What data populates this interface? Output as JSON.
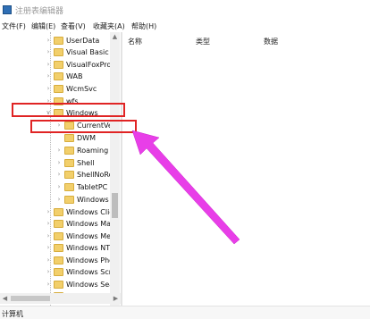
{
  "window": {
    "title": "注册表编辑器"
  },
  "menu": [
    "文件(F)",
    "编辑(E)",
    "查看(V)",
    "收藏夹(A)",
    "帮助(H)"
  ],
  "tree": {
    "items": [
      {
        "label": "UserData",
        "expand": "›"
      },
      {
        "label": "Visual Basic",
        "expand": "›"
      },
      {
        "label": "VisualFoxPro",
        "expand": "›"
      },
      {
        "label": "WAB",
        "expand": "›"
      },
      {
        "label": "WcmSvc",
        "expand": "›"
      },
      {
        "label": "wfs",
        "expand": "›"
      },
      {
        "label": "Windows",
        "expand": "∨"
      },
      {
        "label": "CurrentVe",
        "expand": "›"
      },
      {
        "label": "DWM",
        "expand": ""
      },
      {
        "label": "Roaming",
        "expand": "›"
      },
      {
        "label": "Shell",
        "expand": "›"
      },
      {
        "label": "ShellNoRo",
        "expand": "›"
      },
      {
        "label": "TabletPC",
        "expand": "›"
      },
      {
        "label": "Windows",
        "expand": "›"
      },
      {
        "label": "Windows Clie",
        "expand": "›"
      },
      {
        "label": "Windows Ma",
        "expand": "›"
      },
      {
        "label": "Windows Me",
        "expand": "›"
      },
      {
        "label": "Windows NT",
        "expand": "›"
      },
      {
        "label": "Windows Pho",
        "expand": "›"
      },
      {
        "label": "Windows Scr",
        "expand": "›"
      },
      {
        "label": "Windows Sea",
        "expand": "›"
      },
      {
        "label": "Windows Sel",
        "expand": "›"
      }
    ]
  },
  "columns": {
    "name": "名称",
    "type": "类型",
    "data": "数据"
  },
  "status": {
    "text": "计算机"
  },
  "colors": {
    "highlight": "#e02424",
    "arrow": "#e83ee8",
    "folder": "#f2cf6b"
  }
}
